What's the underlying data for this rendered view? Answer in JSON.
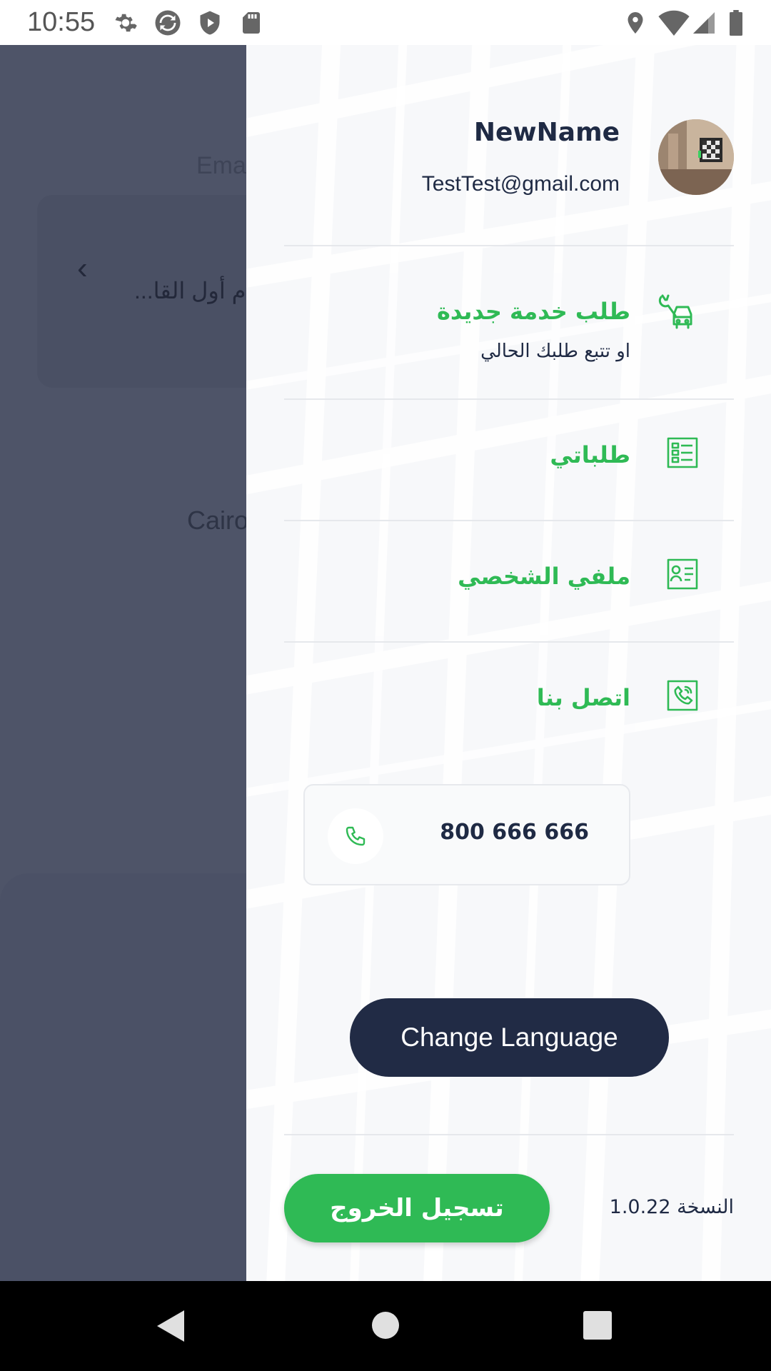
{
  "status_bar": {
    "time": "10:55",
    "left_icons": [
      "gear-icon",
      "sync-icon",
      "shield-play-icon",
      "sd-card-icon"
    ],
    "right_icons": [
      "location-icon",
      "wifi-icon",
      "signal-icon",
      "battery-icon"
    ]
  },
  "background": {
    "email_label": "Ema",
    "field_value": "...م أول القا",
    "city_label": "Cairo"
  },
  "drawer": {
    "profile": {
      "name": "NewName",
      "email": "TestTest@gmail.com",
      "avatar": "avatar"
    },
    "menu": [
      {
        "title": "طلب خدمة جديدة",
        "subtitle": "او تتبع طلبك الحالي",
        "icon": "wrench-car-icon"
      },
      {
        "title": "طلباتي",
        "icon": "orders-list-icon"
      },
      {
        "title": "ملفي الشخصي",
        "icon": "profile-card-icon"
      },
      {
        "title": "اتصل بنا",
        "icon": "phone-call-icon"
      }
    ],
    "contact_phone": "800 666 666",
    "change_language_label": "Change Language",
    "logout_label": "تسجيل الخروج",
    "version_label": "النسخة 1.0.22"
  },
  "colors": {
    "accent_green": "#2fba55",
    "navy": "#212b45",
    "overlay": "#4e5468"
  }
}
